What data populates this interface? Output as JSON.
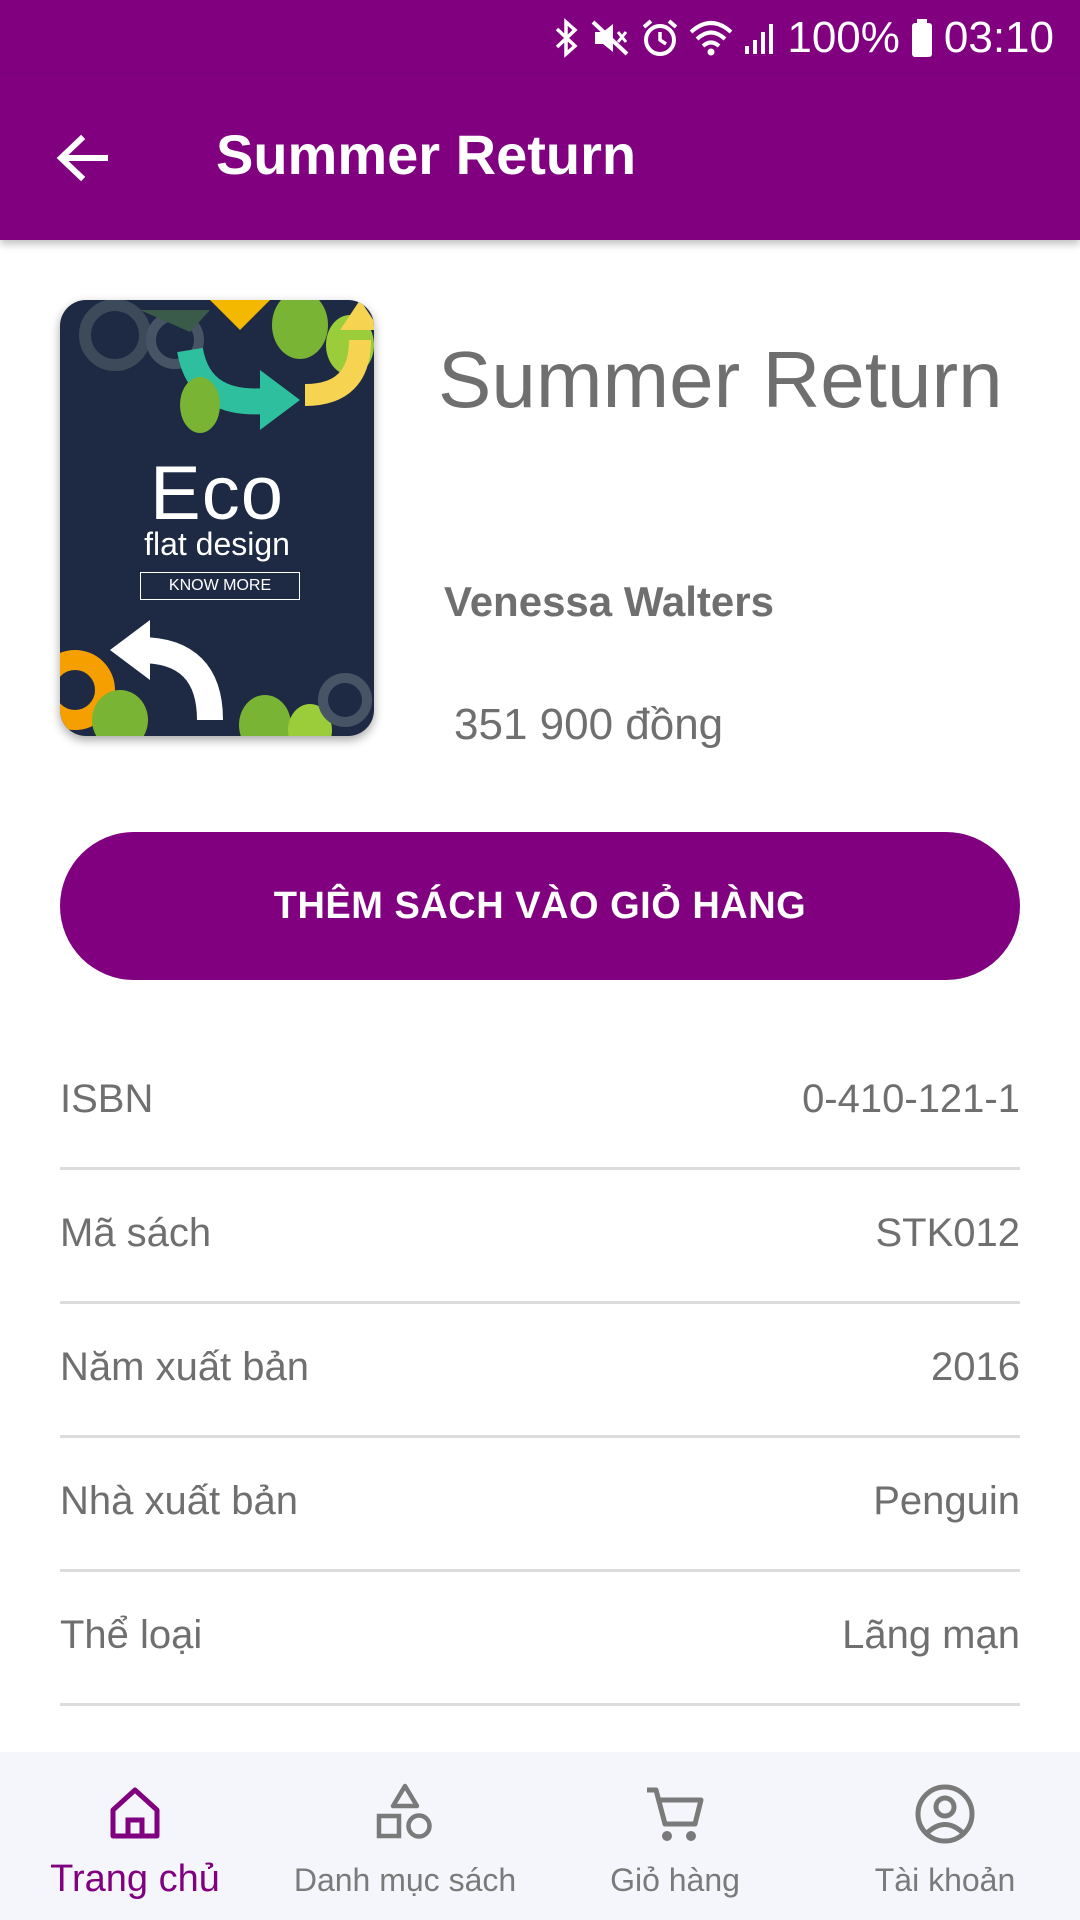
{
  "status_bar": {
    "battery": "100%",
    "time": "03:10",
    "icons": [
      "bluetooth-icon",
      "mute-icon",
      "alarm-icon",
      "wifi-icon",
      "signal-icon",
      "battery-icon"
    ]
  },
  "app_bar": {
    "title": "Summer Return",
    "back_icon": "arrow-left-icon"
  },
  "book": {
    "cover": {
      "title": "Eco",
      "subtitle": "flat design",
      "button": "KNOW MORE"
    },
    "title": "Summer Return",
    "author": "Venessa Walters",
    "price": "351 900 đồng"
  },
  "add_to_cart_label": "THÊM SÁCH VÀO GIỎ HÀNG",
  "details": [
    {
      "label": "ISBN",
      "value": "0-410-121-1"
    },
    {
      "label": "Mã sách",
      "value": "STK012"
    },
    {
      "label": "Năm xuất bản",
      "value": "2016"
    },
    {
      "label": "Nhà xuất bản",
      "value": "Penguin"
    },
    {
      "label": "Thể loại",
      "value": "Lãng mạn"
    }
  ],
  "bottom_nav": [
    {
      "label": "Trang chủ",
      "icon": "home-icon",
      "active": true
    },
    {
      "label": "Danh mục sách",
      "icon": "shapes-icon",
      "active": false
    },
    {
      "label": "Giỏ hàng",
      "icon": "cart-icon",
      "active": false
    },
    {
      "label": "Tài khoản",
      "icon": "account-icon",
      "active": false
    }
  ],
  "colors": {
    "primary": "#800080",
    "text": "#6f6f6f",
    "divider": "#dcdcdc",
    "nav_background": "#f5f6fb"
  }
}
